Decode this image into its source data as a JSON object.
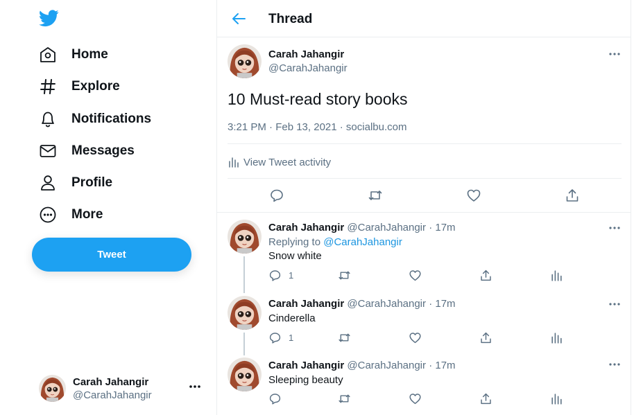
{
  "colors": {
    "brand": "#1da1f2",
    "text": "#0f1419",
    "secondary": "#5b7083",
    "border": "#ebeef0",
    "mention": "#1b95e0"
  },
  "sidebar": {
    "logo_icon": "twitter-bird-icon",
    "nav": [
      {
        "label": "Home",
        "icon": "home-icon"
      },
      {
        "label": "Explore",
        "icon": "hashtag-icon"
      },
      {
        "label": "Notifications",
        "icon": "bell-icon"
      },
      {
        "label": "Messages",
        "icon": "envelope-icon"
      },
      {
        "label": "Profile",
        "icon": "person-icon"
      },
      {
        "label": "More",
        "icon": "more-circle-icon"
      }
    ],
    "tweet_button": "Tweet",
    "account": {
      "name": "Carah Jahangir",
      "handle": "@CarahJahangir"
    }
  },
  "header": {
    "title": "Thread"
  },
  "main_tweet": {
    "name": "Carah Jahangir",
    "handle": "@CarahJahangir",
    "text": "10 Must-read story books",
    "meta": "3:21 PM · Feb 13, 2021 · socialbu.com",
    "activity_label": "View Tweet activity"
  },
  "replies": [
    {
      "name": "Carah Jahangir",
      "handle": "@CarahJahangir",
      "time": "17m",
      "replying_prefix": "Replying to",
      "replying_to": "@CarahJahangir",
      "text": "Snow white",
      "reply_count": "1"
    },
    {
      "name": "Carah Jahangir",
      "handle": "@CarahJahangir",
      "time": "17m",
      "text": "Cinderella",
      "reply_count": "1"
    },
    {
      "name": "Carah Jahangir",
      "handle": "@CarahJahangir",
      "time": "17m",
      "text": "Sleeping beauty",
      "reply_count": ""
    }
  ],
  "sep": "·"
}
